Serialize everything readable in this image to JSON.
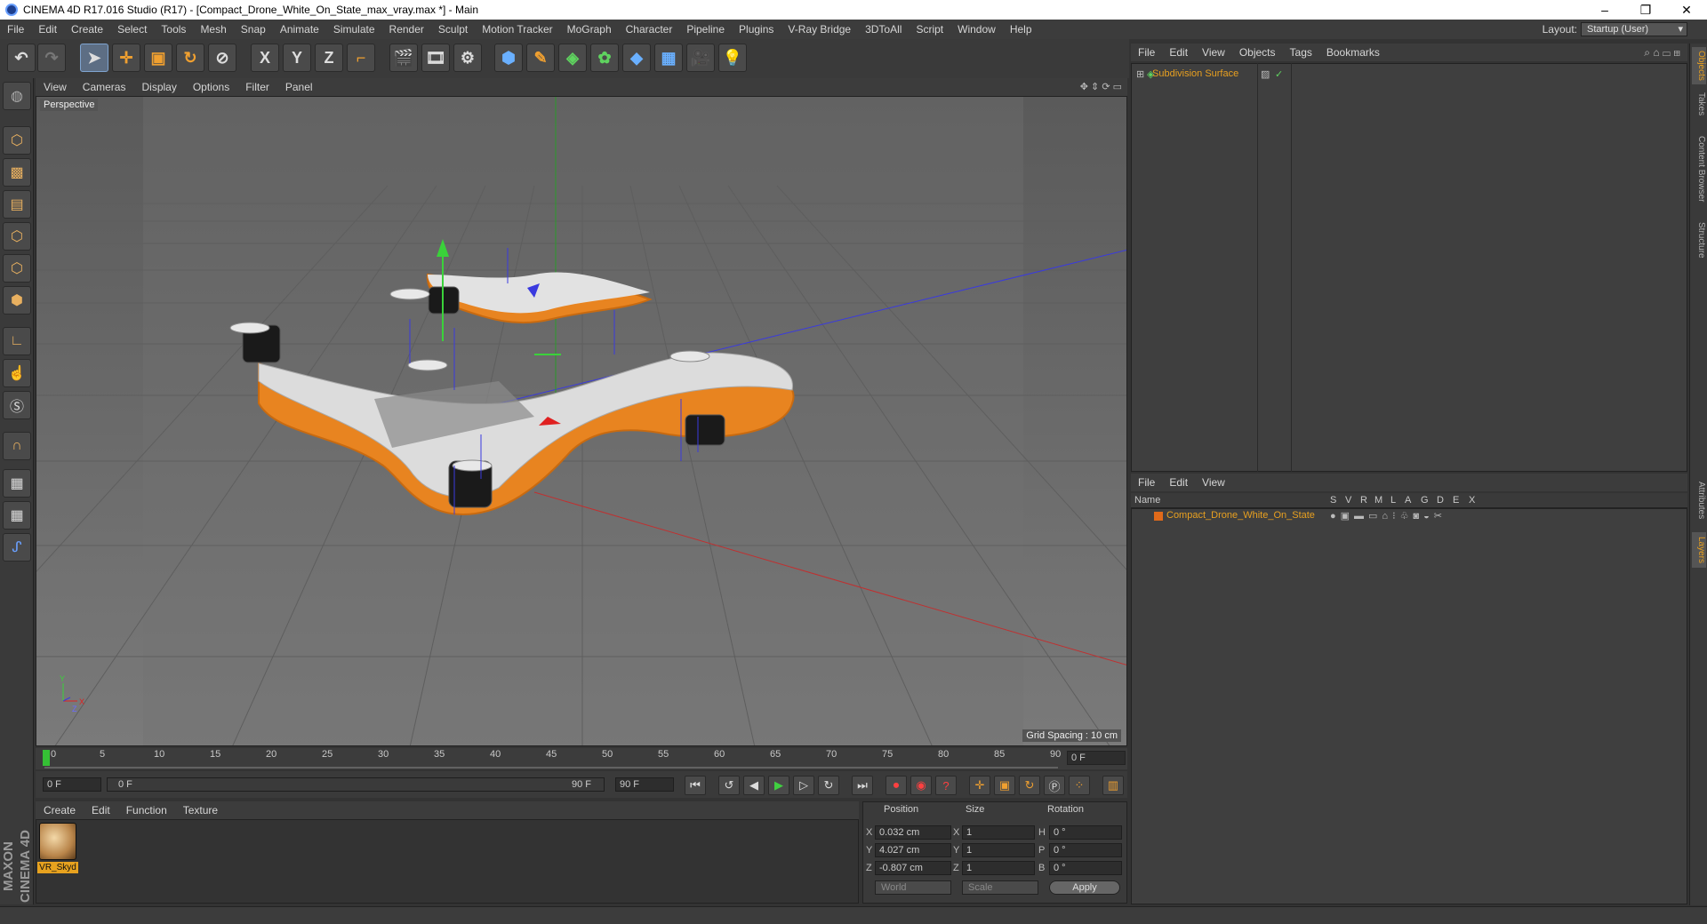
{
  "window": {
    "title": "CINEMA 4D R17.016 Studio (R17) - [Compact_Drone_White_On_State_max_vray.max *] - Main",
    "controls": {
      "minimize": "–",
      "maximize": "❐",
      "close": "✕"
    }
  },
  "menubar": {
    "items": [
      "File",
      "Edit",
      "Create",
      "Select",
      "Tools",
      "Mesh",
      "Snap",
      "Animate",
      "Simulate",
      "Render",
      "Sculpt",
      "Motion Tracker",
      "MoGraph",
      "Character",
      "Pipeline",
      "Plugins",
      "V-Ray Bridge",
      "3DToAll",
      "Script",
      "Window",
      "Help"
    ],
    "layout_label": "Layout:",
    "layout_value": "Startup (User)"
  },
  "toolbar": {
    "icons": [
      "undo-icon",
      "redo-icon",
      "select-arrow-icon",
      "move-icon",
      "scale-icon",
      "rotate-icon",
      "live-select-icon",
      "x-axis-icon",
      "y-axis-icon",
      "z-axis-icon",
      "coordinate-system-icon",
      "render-view-icon",
      "render-picture-viewer-icon",
      "edit-render-settings-icon",
      "cube-icon",
      "pen-spline-icon",
      "subdivision-nurbs-icon",
      "cloner-icon",
      "deformer-icon",
      "floor-icon",
      "camera-icon",
      "light-icon"
    ],
    "axis_labels": {
      "x": "X",
      "y": "Y",
      "z": "Z"
    }
  },
  "left_tools": [
    "make-editable-icon",
    "model-mode-icon",
    "texture-mode-icon",
    "workplane-icon",
    "points-mode-icon",
    "edges-mode-icon",
    "polygons-mode-icon",
    "axis-mode-icon",
    "tweak-mode-icon",
    "solo-icon",
    "magnet-icon",
    "lock-workplane-icon",
    "snap-grid-icon",
    "python-icon"
  ],
  "viewport": {
    "menus": [
      "View",
      "Cameras",
      "Display",
      "Options",
      "Filter",
      "Panel"
    ],
    "camera_label": "Perspective",
    "grid_spacing": "Grid Spacing : 10 cm",
    "axis_labels": {
      "x": "X",
      "y": "Y",
      "z": "Z"
    }
  },
  "timeline": {
    "ticks": [
      "0",
      "5",
      "10",
      "15",
      "20",
      "25",
      "30",
      "35",
      "40",
      "45",
      "50",
      "55",
      "60",
      "65",
      "70",
      "75",
      "80",
      "85",
      "90"
    ],
    "current_frame": "0 F",
    "start_field": "0 F",
    "range_start": "0 F",
    "range_end": "90 F",
    "end_field": "90 F"
  },
  "material_manager": {
    "menus": [
      "Create",
      "Edit",
      "Function",
      "Texture"
    ],
    "materials": [
      {
        "name": "VR_Skyd"
      }
    ]
  },
  "coordinates": {
    "headers": {
      "position": "Position",
      "size": "Size",
      "rotation": "Rotation"
    },
    "rows": [
      {
        "axis": "X",
        "pos": "0.032 cm",
        "size_axis": "X",
        "size": "1",
        "rot_axis": "H",
        "rot": "0 °"
      },
      {
        "axis": "Y",
        "pos": "4.027 cm",
        "size_axis": "Y",
        "size": "1",
        "rot_axis": "P",
        "rot": "0 °"
      },
      {
        "axis": "Z",
        "pos": "-0.807 cm",
        "size_axis": "Z",
        "size": "1",
        "rot_axis": "B",
        "rot": "0 °"
      }
    ],
    "mode_world": "World",
    "mode_scale": "Scale",
    "apply_label": "Apply"
  },
  "branding": {
    "logo": "MAXON CINEMA 4D"
  },
  "object_manager": {
    "menus": [
      "File",
      "Edit",
      "View",
      "Objects",
      "Tags",
      "Bookmarks"
    ],
    "objects": [
      {
        "name": "Subdivision Surface"
      }
    ]
  },
  "layer_manager": {
    "menus": [
      "File",
      "Edit",
      "View"
    ],
    "columns": [
      "Name",
      "S",
      "V",
      "R",
      "M",
      "L",
      "A",
      "G",
      "D",
      "E",
      "X"
    ],
    "layers": [
      {
        "name": "Compact_Drone_White_On_State",
        "color": "#e06a1a"
      }
    ]
  },
  "right_tabs": [
    "Objects",
    "Takes",
    "Content Browser",
    "Structure",
    "Attributes",
    "Layers"
  ],
  "colors": {
    "accent": "#e8a020",
    "selection": "#5d6e84"
  }
}
